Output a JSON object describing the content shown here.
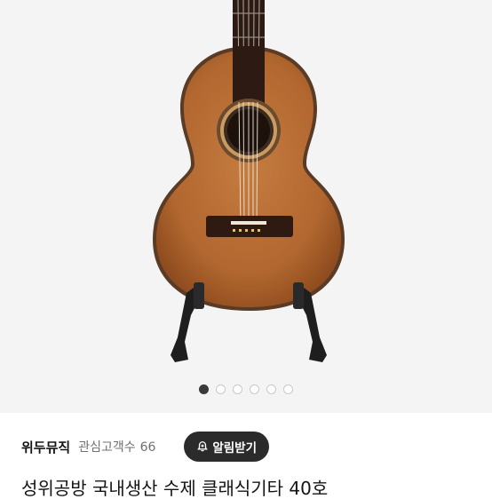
{
  "product_image": {
    "alt": "classical guitar on stand",
    "carousel_total": 6,
    "carousel_active": 1
  },
  "seller": {
    "name": "위두뮤직",
    "followers_label": "관심고객수",
    "followers_count": "66",
    "follow_button_label": "알림받기"
  },
  "listing": {
    "title": "성위공방 국내생산 수제 클래식기타 40호"
  },
  "colors": {
    "button_bg": "#2b2b2b",
    "dot_active": "#3a3a3a",
    "wood": "#b36a34"
  }
}
